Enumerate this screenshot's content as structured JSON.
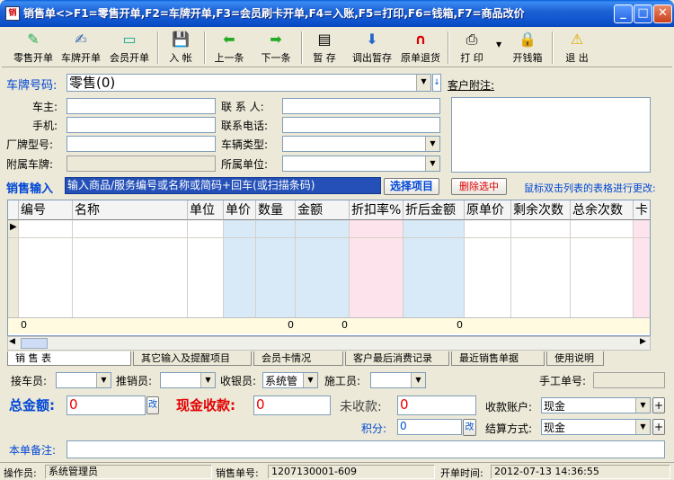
{
  "window": {
    "title": "销售单<>F1=零售开单,F2=车牌开单,F3=会员刷卡开单,F4=入账,F5=打印,F6=钱箱,F7=商品改价",
    "icon_text": "销"
  },
  "toolbar": [
    {
      "name": "retail-order-button",
      "label": "零售开单",
      "icon": "✎"
    },
    {
      "name": "plate-order-button",
      "label": "车牌开单",
      "icon": "✍"
    },
    {
      "name": "member-order-button",
      "label": "会员开单",
      "icon": "▭"
    },
    {
      "name": "post-account-button",
      "label": "入 帐",
      "icon": "💾"
    },
    {
      "name": "prev-button",
      "label": "上一条",
      "icon": "⬅"
    },
    {
      "name": "next-button",
      "label": "下一条",
      "icon": "➡"
    },
    {
      "name": "temp-save-button",
      "label": "暂 存",
      "icon": "▤"
    },
    {
      "name": "load-temp-button",
      "label": "调出暂存",
      "icon": "⬇"
    },
    {
      "name": "return-button",
      "label": "原单退货",
      "icon": "∩"
    },
    {
      "name": "print-button",
      "label": "打 印",
      "icon": "⎙"
    },
    {
      "name": "cashbox-button",
      "label": "开钱箱",
      "icon": "🔒"
    },
    {
      "name": "exit-button",
      "label": "退 出",
      "icon": "⚠"
    }
  ],
  "form": {
    "plate_label": "车牌号码:",
    "plate_value": "零售(0)",
    "remark_label": "客户附注:",
    "owner_label": "车主:",
    "phone_label": "手机:",
    "model_label": "厂牌型号:",
    "attached_label": "附属车牌:",
    "contact_label": "联 系 人:",
    "contact_phone_label": "联系电话:",
    "vehicle_type_label": "车辆类型:",
    "unit_label": "所属单位:"
  },
  "sale": {
    "label": "销售输入",
    "input_text": "输入商品/服务编号或名称或简码+回车(或扫描条码)",
    "select_btn": "选择项目",
    "delete_btn": "删除选中",
    "hint": "鼠标双击列表的表格进行更改:"
  },
  "grid": {
    "columns": [
      "编号",
      "名称",
      "单位",
      "单价",
      "数量",
      "金额",
      "折扣率%",
      "折后金额",
      "原单价",
      "剩余次数",
      "总余次数",
      "卡"
    ],
    "totals": {
      "code": "0",
      "qty": "0",
      "amount": "0",
      "after": "0"
    }
  },
  "tabs": [
    "销 售 表",
    "其它输入及提醒项目",
    "会员卡情况",
    "客户最后消费记录",
    "最近销售单据",
    "使用说明"
  ],
  "staff": {
    "receiver": "接车员:",
    "promoter": "推销员:",
    "cashier": "收银员:",
    "cashier_value": "系统管",
    "worker": "施工员:",
    "manual_no": "手工单号:"
  },
  "money": {
    "total_label": "总金额:",
    "total_value": "0",
    "edit": "改",
    "cash_label": "现金收款:",
    "cash_value": "0",
    "unpaid_label": "未收款:",
    "unpaid_value": "0",
    "points_label": "积分:",
    "points_value": "0",
    "account_label": "收款账户:",
    "account_value": "现金",
    "method_label": "结算方式:",
    "method_value": "现金",
    "plus": "+"
  },
  "note_label": "本单备注:",
  "status": {
    "operator_label": "操作员:",
    "operator": "系统管理员",
    "order_label": "销售单号:",
    "order_no": "1207130001-609",
    "time_label": "开单时间:",
    "time": "2012-07-13 14:36:55"
  }
}
